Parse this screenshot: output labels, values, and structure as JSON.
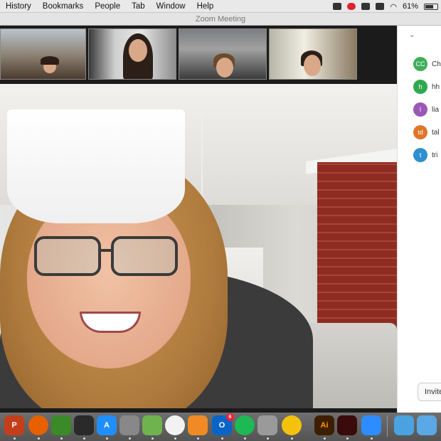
{
  "menubar": {
    "items": [
      "History",
      "Bookmarks",
      "People",
      "Tab",
      "Window",
      "Help"
    ],
    "battery": "61%"
  },
  "window": {
    "title": "Zoom Meeting"
  },
  "participants_panel": {
    "participants": [
      {
        "initials": "CC",
        "name": "Ch",
        "color": "#3fae5a"
      },
      {
        "initials": "h",
        "name": "hh",
        "color": "#2fa84f"
      },
      {
        "initials": "l",
        "name": "lia",
        "color": "#9b59b6"
      },
      {
        "initials": "td",
        "name": "tal",
        "color": "#e0752b"
      },
      {
        "initials": "t",
        "name": "tri",
        "color": "#2f8fcf"
      }
    ],
    "invite_label": "Invite"
  },
  "dock": {
    "apps": [
      {
        "name": "powerpoint-icon",
        "label": "P",
        "color": "#c43e1c"
      },
      {
        "name": "firefox-icon",
        "label": "",
        "color": "#e66000"
      },
      {
        "name": "app-green-icon",
        "label": "",
        "color": "#3a8a2a"
      },
      {
        "name": "app-dark-icon",
        "label": "",
        "color": "#2a2a2a"
      },
      {
        "name": "app-store-icon",
        "label": "A",
        "color": "#1f8fff"
      },
      {
        "name": "system-preferences-icon",
        "label": "",
        "color": "#888888"
      },
      {
        "name": "maps-icon",
        "label": "",
        "color": "#6fb34f"
      },
      {
        "name": "photos-icon",
        "label": "",
        "color": "#f2f2f2"
      },
      {
        "name": "books-icon",
        "label": "",
        "color": "#f08a24"
      },
      {
        "name": "outlook-icon",
        "label": "O",
        "color": "#0a64c8",
        "badge": "6"
      },
      {
        "name": "spotify-icon",
        "label": "",
        "color": "#1db954"
      },
      {
        "name": "app-gray-icon",
        "label": "",
        "color": "#9a9a9a"
      },
      {
        "name": "chrome-icon",
        "label": "",
        "color": "#f4c20d"
      },
      {
        "name": "illustrator-icon",
        "label": "Ai",
        "color": "#3d1f00"
      },
      {
        "name": "acrobat-icon",
        "label": "",
        "color": "#3b0b0b"
      },
      {
        "name": "zoom-icon",
        "label": "",
        "color": "#2d8cff"
      },
      {
        "name": "folder-icon",
        "label": "",
        "color": "#4aa3df"
      },
      {
        "name": "applications-folder-icon",
        "label": "",
        "color": "#5aa9e6"
      }
    ]
  }
}
